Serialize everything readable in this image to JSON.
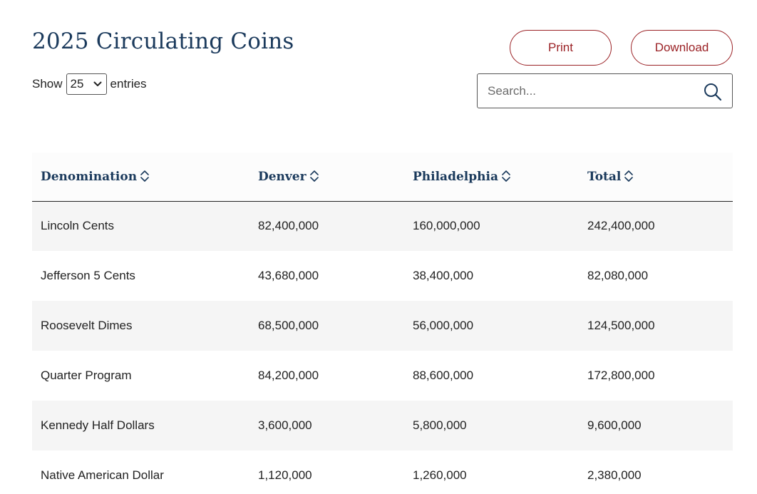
{
  "page": {
    "title": "2025 Circulating Coins"
  },
  "actions": {
    "print_label": "Print",
    "download_label": "Download"
  },
  "length_control": {
    "prefix": "Show",
    "selected": "25",
    "suffix": "entries"
  },
  "search": {
    "placeholder": "Search...",
    "icon": "search-icon"
  },
  "table": {
    "columns": [
      "Denomination",
      "Denver",
      "Philadelphia",
      "Total"
    ],
    "rows": [
      [
        "Lincoln Cents",
        "82,400,000",
        "160,000,000",
        "242,400,000"
      ],
      [
        "Jefferson 5 Cents",
        "43,680,000",
        "38,400,000",
        "82,080,000"
      ],
      [
        "Roosevelt Dimes",
        "68,500,000",
        "56,000,000",
        "124,500,000"
      ],
      [
        "Quarter Program",
        "84,200,000",
        "88,600,000",
        "172,800,000"
      ],
      [
        "Kennedy Half Dollars",
        "3,600,000",
        "5,800,000",
        "9,600,000"
      ],
      [
        "Native American Dollar",
        "1,120,000",
        "1,260,000",
        "2,380,000"
      ]
    ]
  },
  "colors": {
    "accent": "#9b2226",
    "heading": "#1b3a5c",
    "row_stripe": "#f5f5f5"
  }
}
